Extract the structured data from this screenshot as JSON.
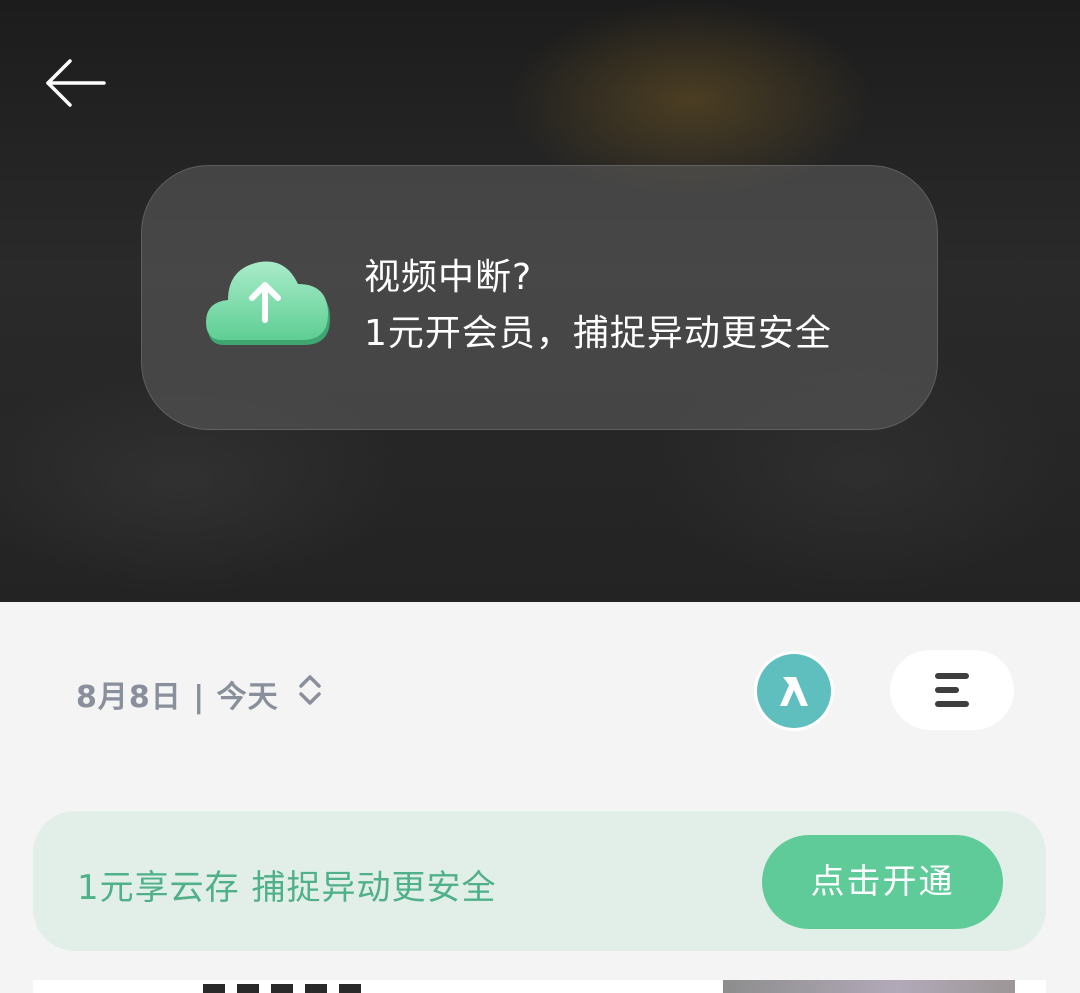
{
  "video_overlay": {
    "back_icon": "arrow-left-icon",
    "promo": {
      "icon": "cloud-upload-icon",
      "line1": "视频中断?",
      "line2": "1元开会员，捕捉异动更安全"
    }
  },
  "toolbar": {
    "date": "8月8日 | 今天",
    "date_toggle_icon": "chevron-up-down-icon",
    "avatar_icon": "person-icon",
    "menu_icon": "list-menu-icon"
  },
  "vip_banner": {
    "text": "1元享云存 捕捉异动更安全",
    "button_label": "点击开通"
  },
  "colors": {
    "accent_green": "#5ecb98",
    "banner_bg": "#e2efe9",
    "banner_text": "#4fb089",
    "avatar_teal": "#5fbfbf"
  }
}
